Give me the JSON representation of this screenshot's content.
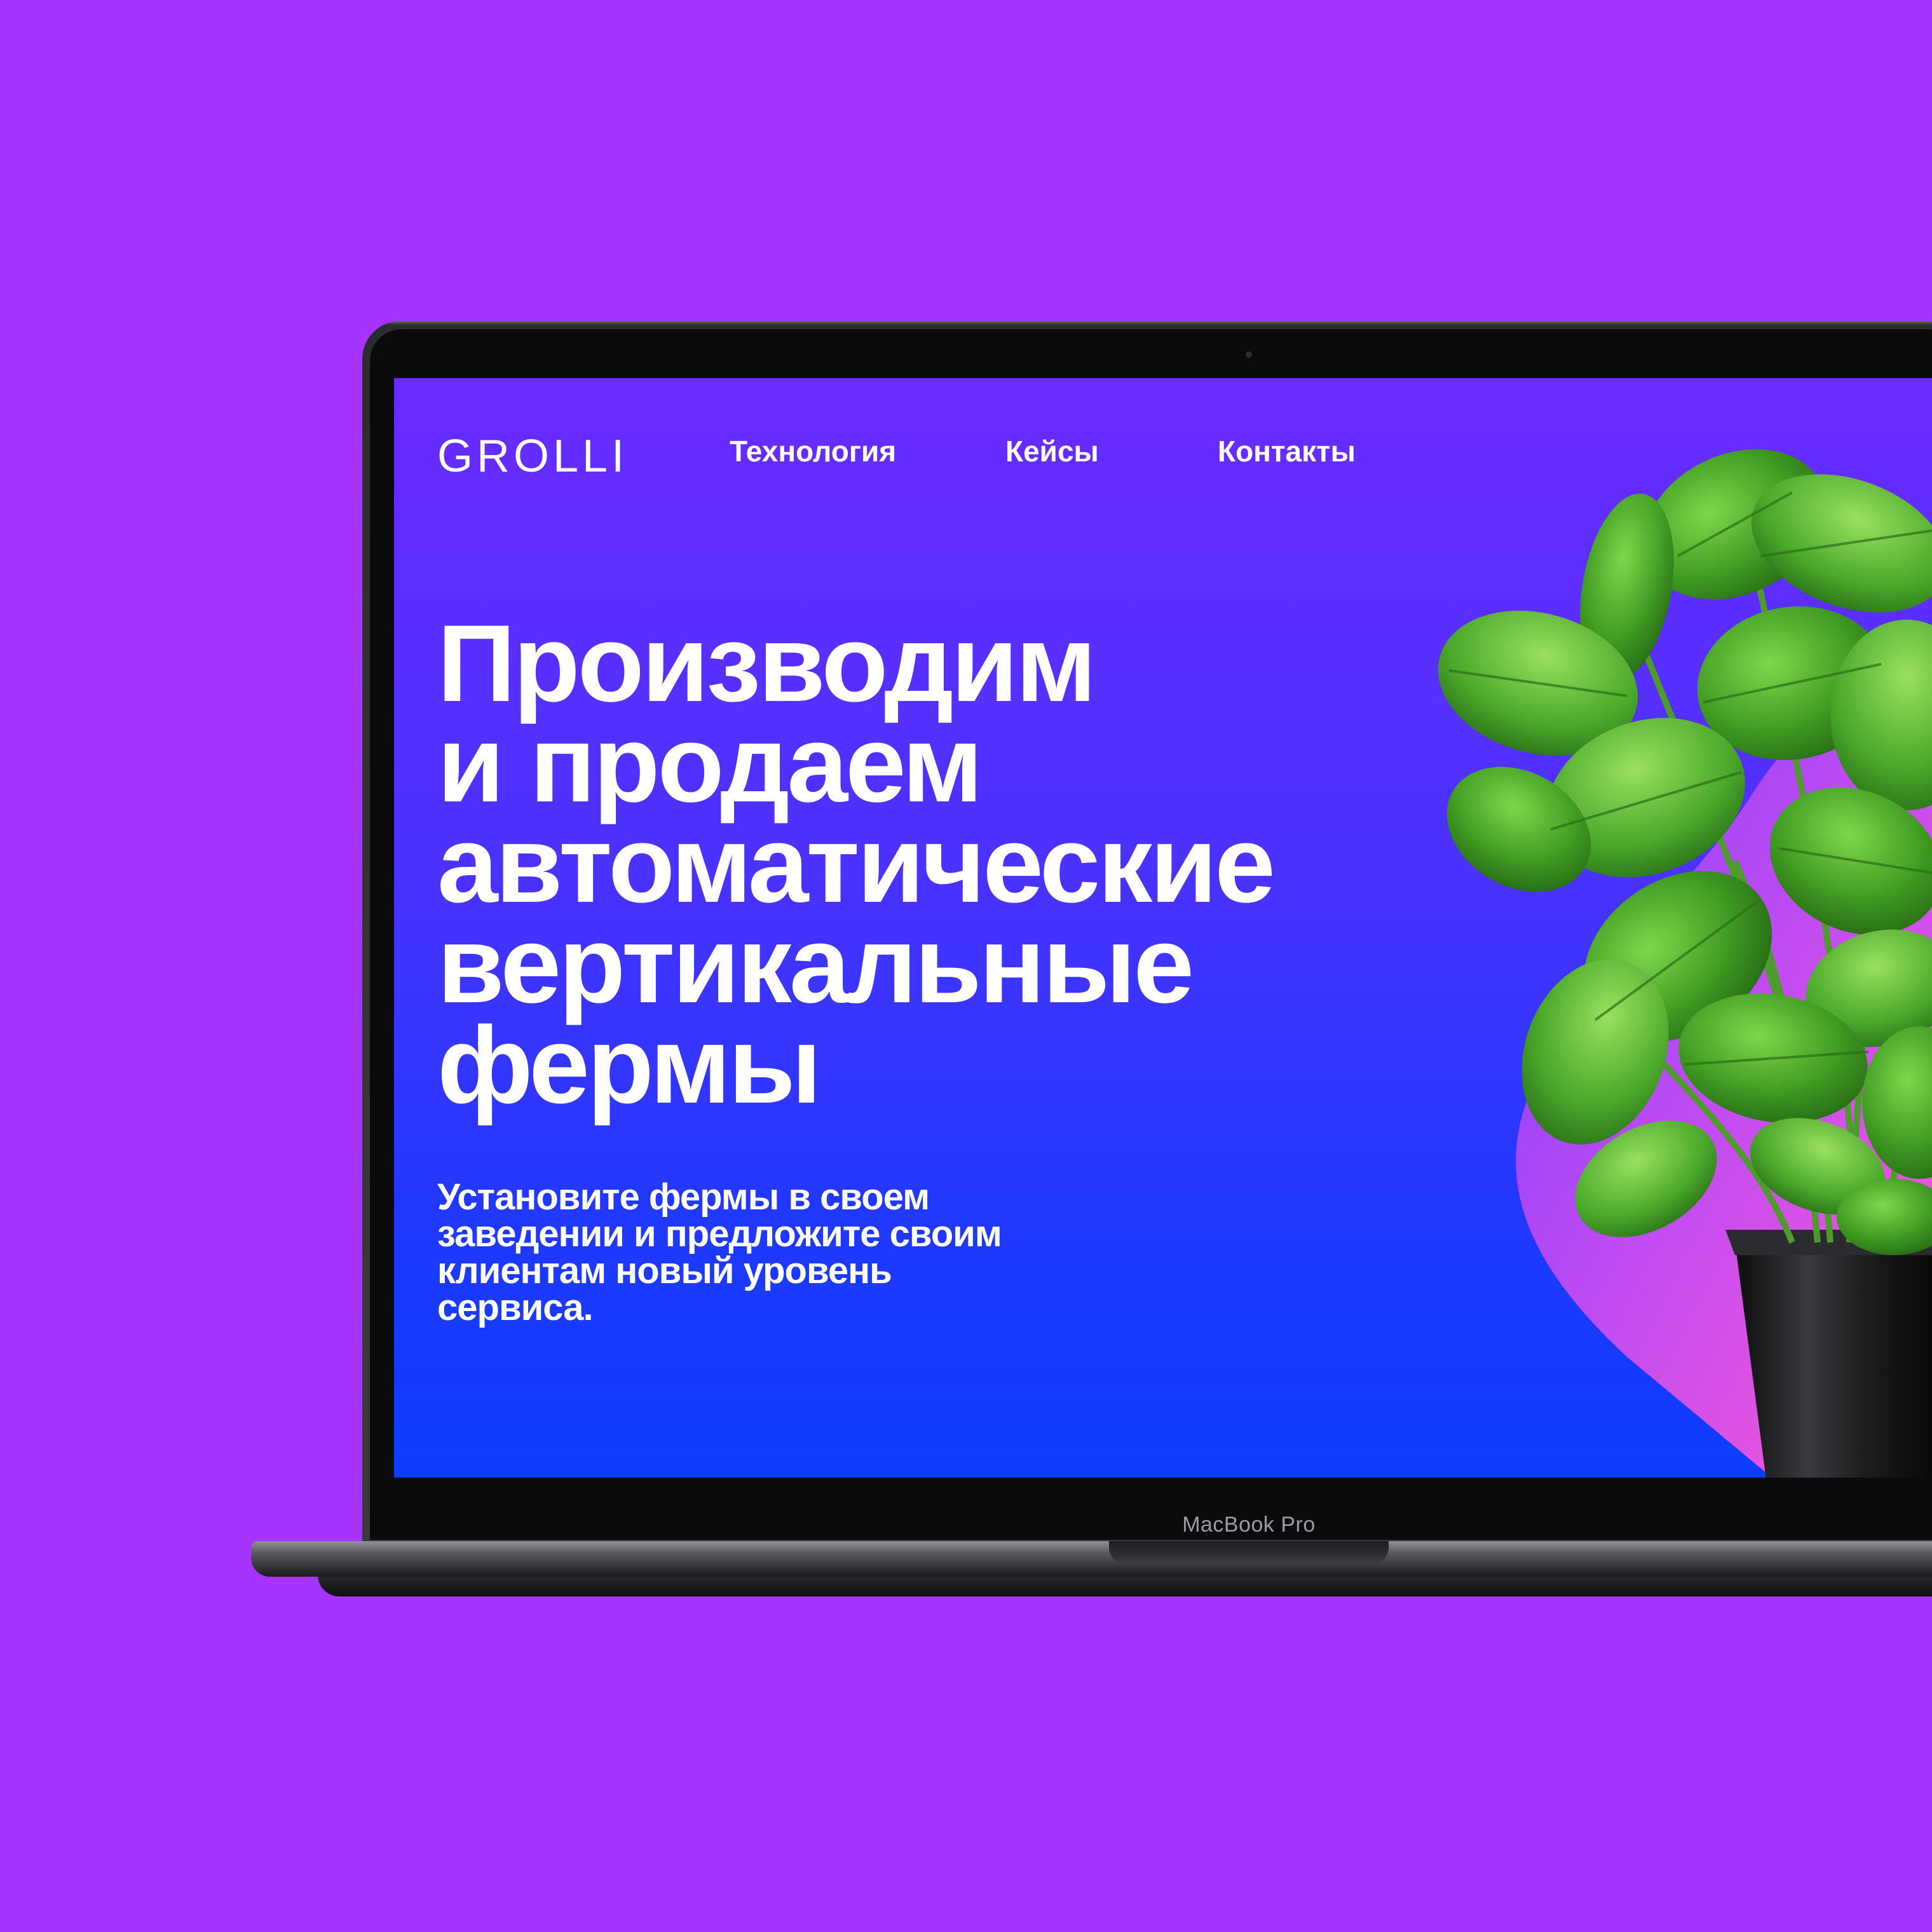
{
  "site": {
    "logo": "GROLLI",
    "nav": [
      "Технология",
      "Кейсы",
      "Контакты"
    ],
    "headline_lines": [
      "Производим",
      "и продаем",
      "автоматические",
      "вертикальные",
      "фермы"
    ],
    "subtext": "Установите фермы в своем заведении и предложите своим клиентам новый уровень сервиса."
  },
  "device": {
    "label": "MacBook Pro"
  },
  "colors": {
    "page_background": "#a733ff",
    "screen_gradient_top": "#6a2bff",
    "screen_gradient_bottom": "#0d3cff",
    "accent_pink": "#ff5ad2",
    "text": "#ffffff"
  },
  "icons": {
    "hero_image": "basil-plant-in-pot"
  }
}
